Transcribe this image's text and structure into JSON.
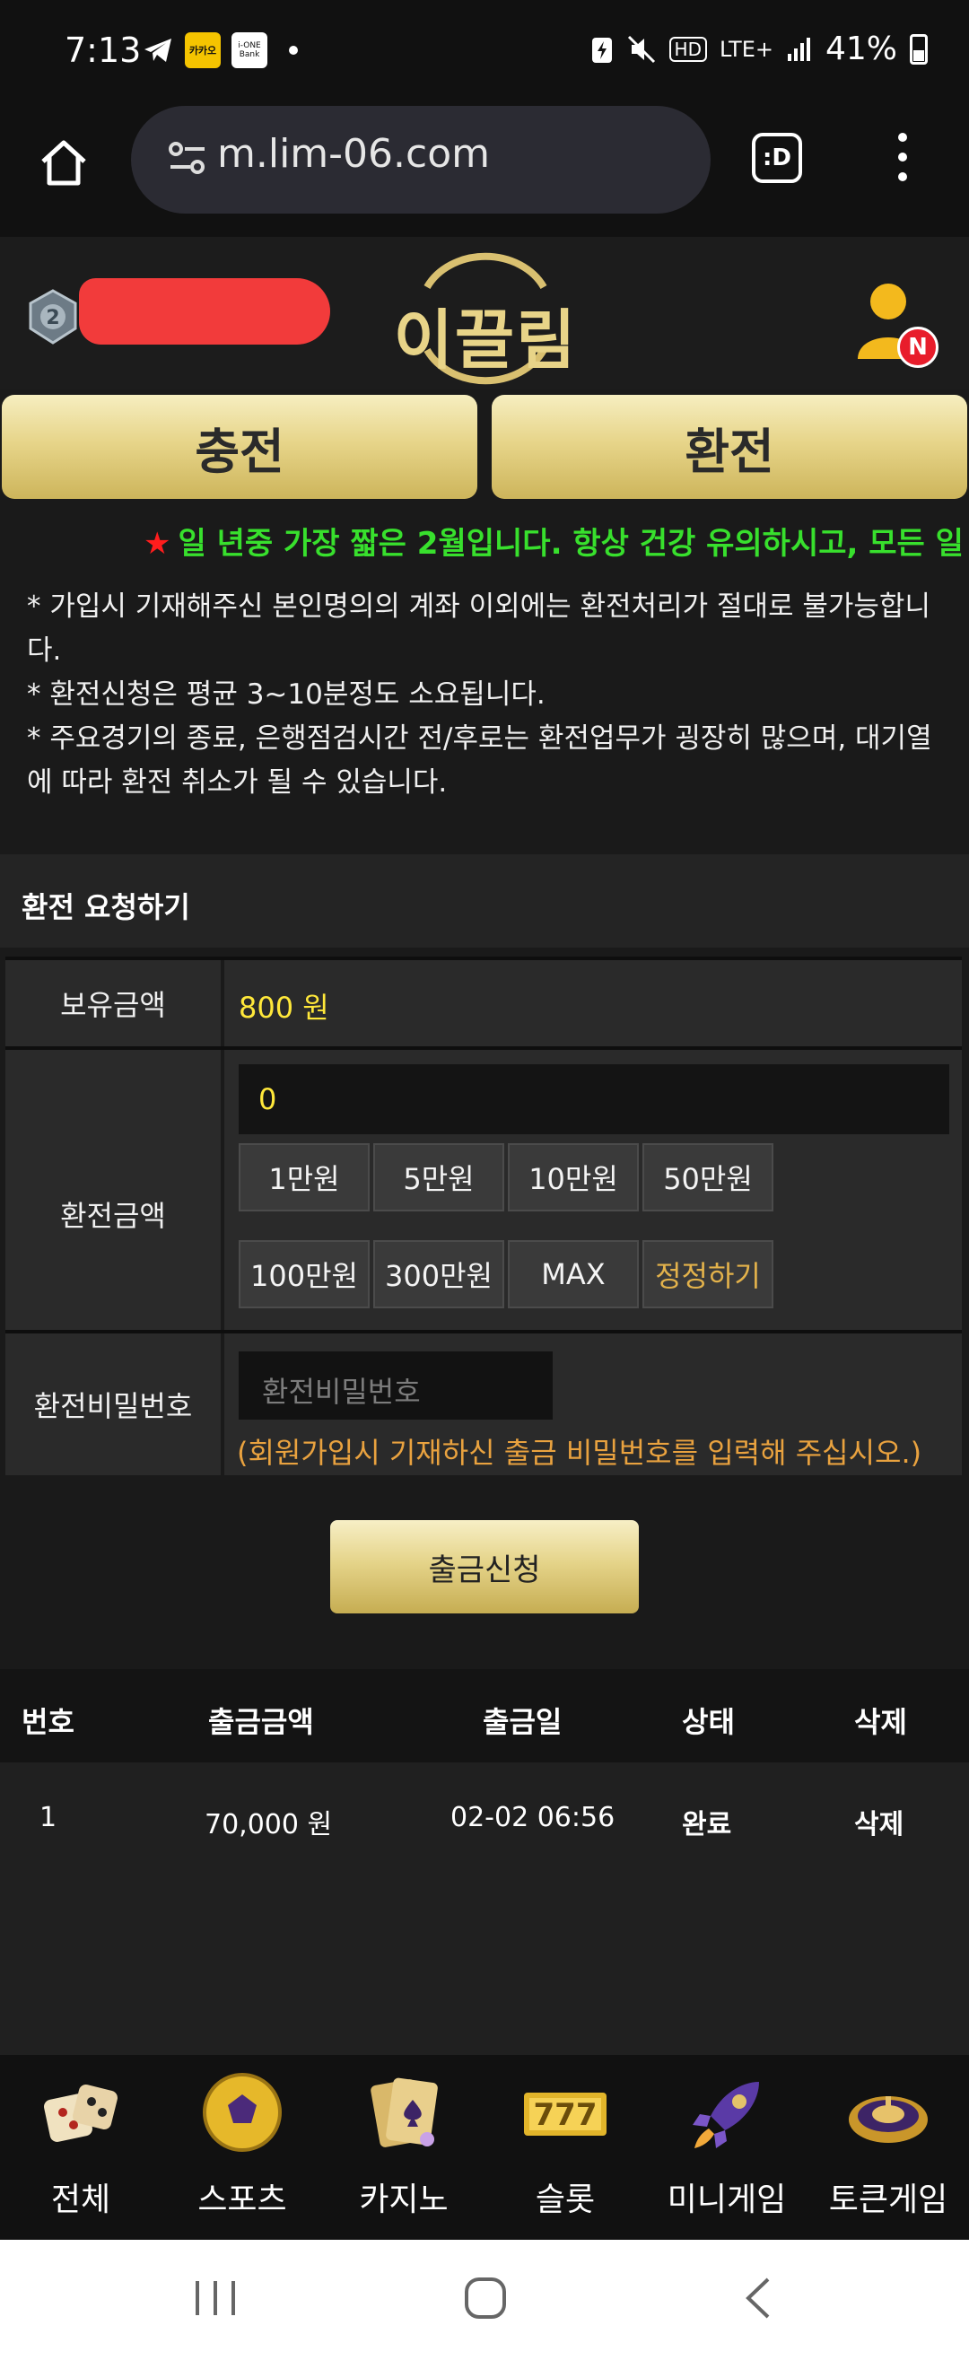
{
  "status_bar": {
    "time": "7:13",
    "app_icon_1": "카카오",
    "app_icon_2": "i-ONE Bank",
    "network_hd": "HD",
    "network": "LTE+",
    "battery": "41%"
  },
  "browser": {
    "url": "m.lim-06.com",
    "tab_label": ":D"
  },
  "header": {
    "logo_text": "이끌림",
    "notification_badge": "N"
  },
  "actions": {
    "deposit_label": "충전",
    "withdraw_label": "환전"
  },
  "marquee": {
    "star": "★",
    "text": "일 년중 가장 짧은 2월입니다. 항상 건강 유의하시고, 모든 일"
  },
  "notice": {
    "line1": "* 가입시 기재해주신 본인명의의 계좌 이외에는 환전처리가 절대로 불가능합니다.",
    "line2": "* 환전신청은 평균 3~10분정도 소요됩니다.",
    "line3": "* 주요경기의 종료, 은행점검시간 전/후로는 환전업무가 굉장히 많으며, 대기열에 따라 환전 취소가 될 수 있습니다."
  },
  "withdraw_form": {
    "section_title": "환전 요청하기",
    "balance_label": "보유금액",
    "balance_value": "800 원",
    "amount_label": "환전금액",
    "amount_value": "0",
    "quick_buttons": [
      "1만원",
      "5만원",
      "10만원",
      "50만원",
      "100만원",
      "300만원",
      "MAX",
      "정정하기"
    ],
    "password_label": "환전비밀번호",
    "password_placeholder": "환전비밀번호",
    "password_hint": "(회원가입시 기재하신 출금 비밀번호를 입력해 주십시오.)",
    "submit_label": "출금신청"
  },
  "history": {
    "headers": [
      "번호",
      "출금금액",
      "출금일",
      "상태",
      "삭제"
    ],
    "rows": [
      {
        "no": "1",
        "amount": "70,000 원",
        "date": "02-02 06:56",
        "status": "완료",
        "delete": "삭제"
      }
    ]
  },
  "bottom_nav": [
    {
      "label": "전체",
      "icon": "dice-icon"
    },
    {
      "label": "스포츠",
      "icon": "soccer-ball-icon"
    },
    {
      "label": "카지노",
      "icon": "cards-icon"
    },
    {
      "label": "슬롯",
      "icon": "slot-777-icon"
    },
    {
      "label": "미니게임",
      "icon": "rocket-icon"
    },
    {
      "label": "토큰게임",
      "icon": "roulette-icon"
    }
  ],
  "colors": {
    "gold": "#e7d58a",
    "marquee_green": "#38e02d",
    "amount_yellow": "#ffe83a",
    "hint_orange": "#e9a23f",
    "badge_red": "#e81d2b"
  }
}
